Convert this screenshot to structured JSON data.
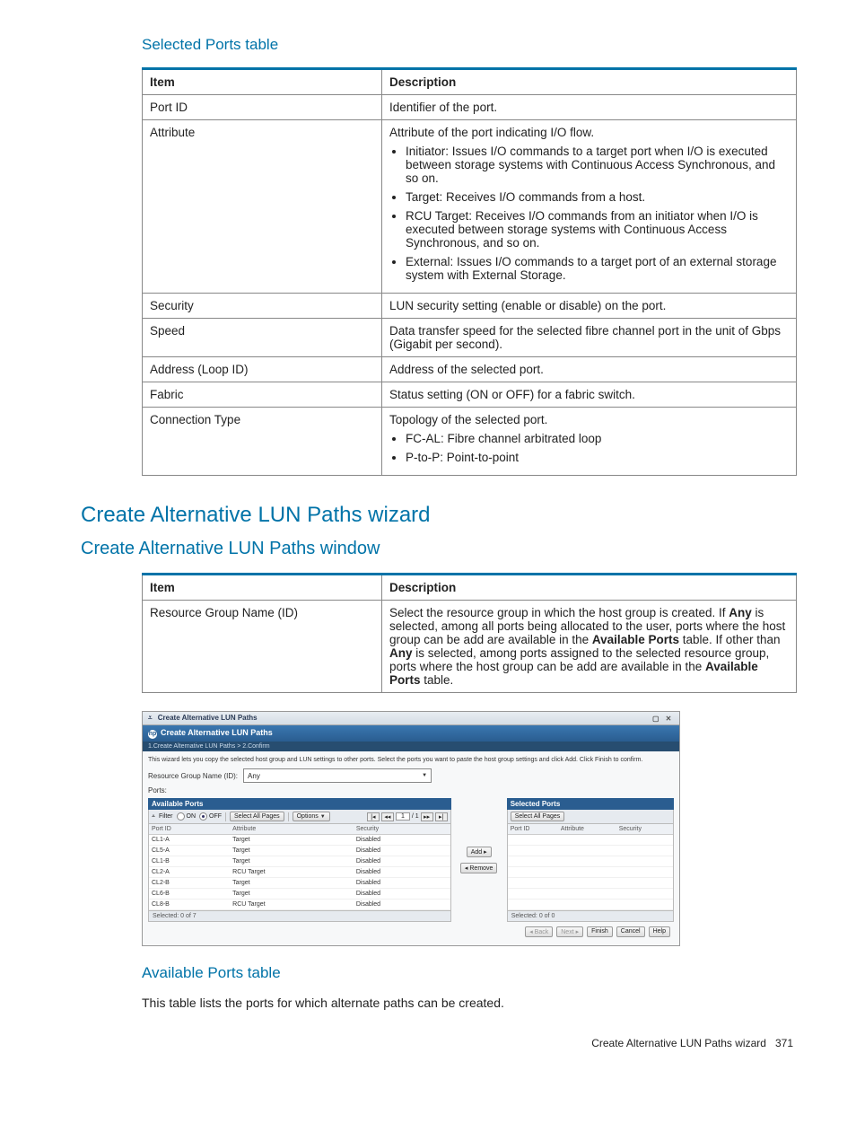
{
  "section1_title": "Selected Ports table",
  "table1": {
    "h1": "Item",
    "h2": "Description",
    "r1c1": "Port ID",
    "r1c2": "Identifier of the port.",
    "r2c1": "Attribute",
    "r2c2_intro": "Attribute of the port indicating I/O flow.",
    "r2c2_b1": "Initiator: Issues I/O commands to a target port when I/O is executed between storage systems with Continuous Access Synchronous, and so on.",
    "r2c2_b2": "Target: Receives I/O commands from a host.",
    "r2c2_b3": "RCU Target: Receives I/O commands from an initiator when I/O is executed between storage systems with Continuous Access Synchronous, and so on.",
    "r2c2_b4": "External: Issues I/O commands to a target port of an external storage system with External Storage.",
    "r3c1": "Security",
    "r3c2": "LUN security setting (enable or disable) on the port.",
    "r4c1": "Speed",
    "r4c2": "Data transfer speed for the selected fibre channel port in the unit of Gbps (Gigabit per second).",
    "r5c1": "Address (Loop ID)",
    "r5c2": "Address of the selected port.",
    "r6c1": "Fabric",
    "r6c2": "Status setting (ON or OFF) for a fabric switch.",
    "r7c1": "Connection Type",
    "r7c2_intro": "Topology of the selected port.",
    "r7c2_b1": "FC-AL: Fibre channel arbitrated loop",
    "r7c2_b2": "P-to-P: Point-to-point"
  },
  "h2_title": "Create Alternative LUN Paths wizard",
  "h3_title": "Create Alternative LUN Paths window",
  "table2": {
    "h1": "Item",
    "h2": "Description",
    "r1c1": "Resource Group Name (ID)",
    "r1c2_p1": "Select the resource group in which the host group is created. If ",
    "r1c2_b1": "Any",
    "r1c2_p2": " is selected, among all ports being allocated to the user, ports where the host group can be add are available in the ",
    "r1c2_b2": "Available Ports",
    "r1c2_p3": " table. If other than ",
    "r1c2_b3": "Any",
    "r1c2_p4": " is selected, among ports assigned to the selected resource group, ports where the host group can be add are available in the ",
    "r1c2_b4": "Available Ports",
    "r1c2_p5": " table."
  },
  "screenshot": {
    "win_title": "Create Alternative LUN Paths",
    "header": "Create Alternative LUN Paths",
    "breadcrumb": "1.Create Alternative LUN Paths  >  2.Confirm",
    "instructions": "This wizard lets you copy the selected host group and LUN settings to other ports. Select the ports you want to paste the host group settings and click Add. Click Finish to confirm.",
    "rg_label": "Resource Group Name (ID):",
    "rg_value": "Any",
    "ports_label": "Ports:",
    "left": {
      "title": "Available Ports",
      "filter_label": "Filter",
      "on": "ON",
      "off": "OFF",
      "select_all": "Select All Pages",
      "options": "Options",
      "page_of": "/ 1",
      "cols": {
        "c1": "Port ID",
        "c2": "Attribute",
        "c3": "Security"
      },
      "rows": [
        {
          "c1": "CL1-A",
          "c2": "Target",
          "c3": "Disabled"
        },
        {
          "c1": "CL5-A",
          "c2": "Target",
          "c3": "Disabled"
        },
        {
          "c1": "CL1-B",
          "c2": "Target",
          "c3": "Disabled"
        },
        {
          "c1": "CL2-A",
          "c2": "RCU Target",
          "c3": "Disabled"
        },
        {
          "c1": "CL2-B",
          "c2": "Target",
          "c3": "Disabled"
        },
        {
          "c1": "CL6-B",
          "c2": "Target",
          "c3": "Disabled"
        },
        {
          "c1": "CL8-B",
          "c2": "RCU Target",
          "c3": "Disabled"
        }
      ],
      "status": "Selected:  0    of  7"
    },
    "mid": {
      "add": "Add ▸",
      "remove": "◂ Remove"
    },
    "right": {
      "title": "Selected Ports",
      "select_all": "Select All Pages",
      "cols": {
        "c1": "Port ID",
        "c2": "Attribute",
        "c3": "Security"
      },
      "status": "Selected:  0    of  0"
    },
    "footer": {
      "back": "◂ Back",
      "next": "Next ▸",
      "finish": "Finish",
      "cancel": "Cancel",
      "help": "Help"
    }
  },
  "section3_title": "Available Ports table",
  "body_text1": "This table lists the ports for which alternate paths can be created.",
  "footer_text": "Create Alternative LUN Paths wizard",
  "footer_page": "371"
}
